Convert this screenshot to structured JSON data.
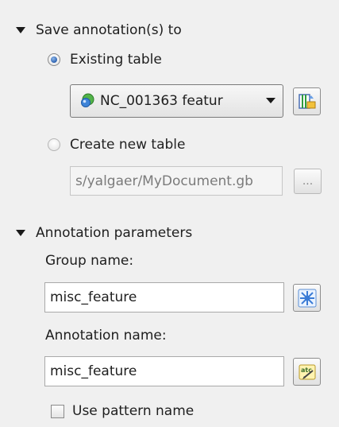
{
  "save_section": {
    "title": "Save annotation(s) to",
    "existing_table_label": "Existing table",
    "existing_table_selected": true,
    "table_combo_value": "NC_001363 featur",
    "create_new_table_label": "Create new table",
    "new_table_path": "s/yalgaer/MyDocument.gb",
    "browse_label": "..."
  },
  "params_section": {
    "title": "Annotation parameters",
    "group_name_label": "Group name:",
    "group_name_value": "misc_feature",
    "annotation_name_label": "Annotation name:",
    "annotation_name_value": "misc_feature",
    "use_pattern_name_label": "Use pattern name",
    "use_pattern_name_checked": false
  },
  "icons": {
    "expand": "triangle-down-icon",
    "table_item": "sequence-object-icon",
    "select_table": "table-select-icon",
    "group_picker": "group-tree-icon",
    "annotation_name_picker": "annotation-text-icon"
  },
  "colors": {
    "background": "#f0f0f0",
    "radio_selected": "#1f55a8",
    "field_border": "#a9a9a9",
    "disabled_text": "#7b7b7b"
  }
}
